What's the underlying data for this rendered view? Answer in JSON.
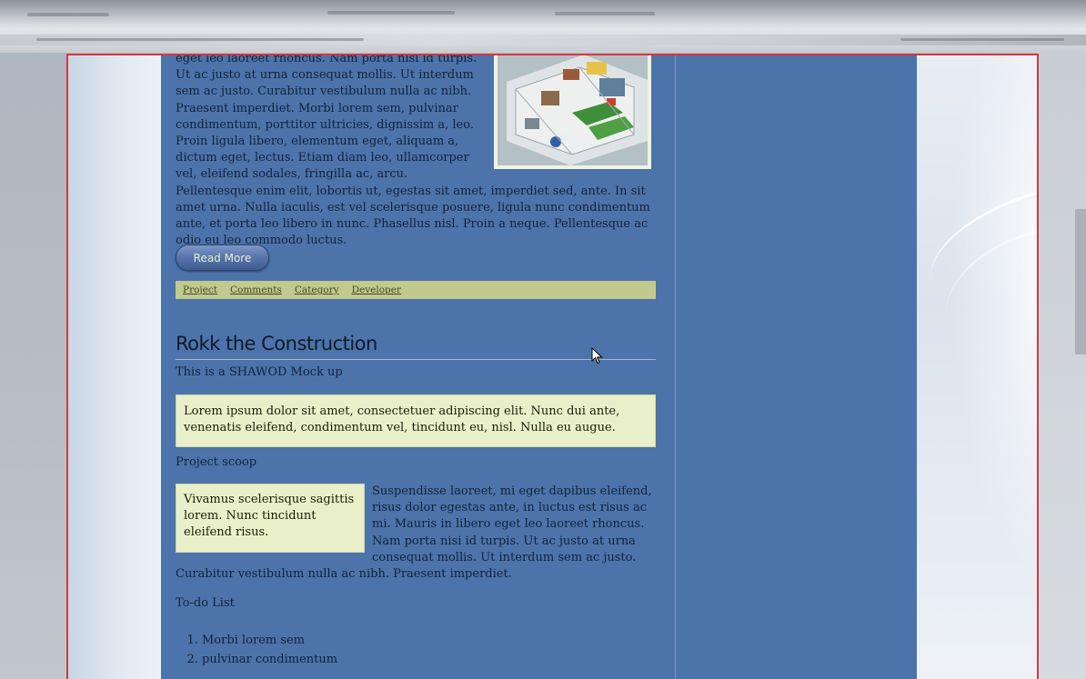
{
  "intro": {
    "paragraph": "eget leo laoreet rhoncus. Nam porta nisi id turpis. Ut ac justo at urna consequat mollis. Ut interdum sem ac justo. Curabitur vestibulum nulla ac nibh. Praesent imperdiet. Morbi lorem sem, pulvinar condimentum, porttitor ultricies, dignissim a, leo. Proin ligula libero, elementum eget, aliquam a, dictum eget, lectus. Etiam diam leo, ullamcorper vel, eleifend sodales, fringilla ac, arcu. Pellentesque enim elit, lobortis ut, egestas sit amet, imperdiet sed, ante. In sit amet urna. Nulla iaculis, est vel scelerisque posuere, ligula nunc condimentum ante, et porta leo libero in nunc. Phasellus nisl. Proin a neque. Pellentesque ac odio eu leo commodo luctus.",
    "read_more": "Read More"
  },
  "meta_links": [
    "Project",
    "Comments",
    "Category",
    "Developer"
  ],
  "post": {
    "title": "Rokk the Construction",
    "subtitle": "This is a SHAWOD Mock up",
    "note": "Lorem ipsum dolor sit amet, consectetuer adipiscing elit. Nunc dui ante, venenatis eleifend, condimentum vel, tincidunt eu, nisl. Nulla eu augue.",
    "scoop_label": "Project scoop",
    "pull_quote": "Vivamus scelerisque sagittis lorem. Nunc tincidunt eleifend risus.",
    "scoop_text": "Suspendisse laoreet, mi eget dapibus eleifend, risus dolor egestas ante, in luctus est risus ac mi. Mauris in libero eget leo laoreet rhoncus. Nam porta nisi id turpis. Ut ac justo at urna consequat mollis. Ut interdum sem ac justo. Curabitur vestibulum nulla ac nibh. Praesent imperdiet.",
    "todo_label": "To-do List",
    "todo_items": [
      "Morbi lorem sem",
      "pulvinar condimentum"
    ]
  },
  "colors": {
    "page_bg": "#4c74aa",
    "meta_bar": "#c2c98e",
    "note_bg": "#e9f0c9",
    "frame": "#d4383e"
  },
  "icons": {
    "cursor": "mouse-pointer-icon"
  }
}
